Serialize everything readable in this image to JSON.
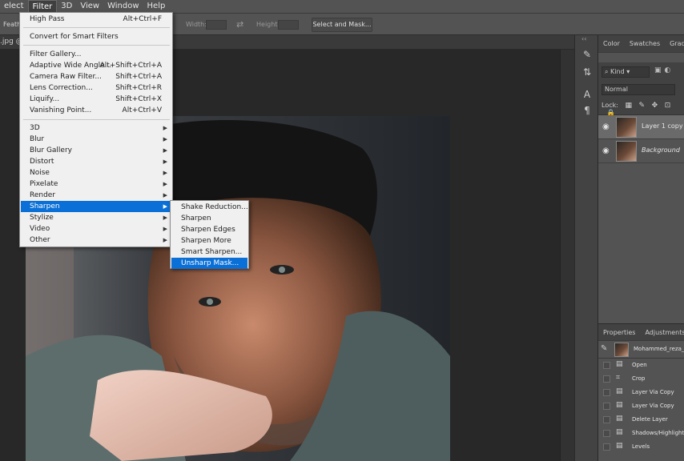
{
  "menubar": [
    "elect",
    "Filter",
    "3D",
    "View",
    "Window",
    "Help"
  ],
  "options": {
    "feather_label": "Feath",
    "width_label": "Width:",
    "height_label": "Height:",
    "select_mask_button": "Select and Mask..."
  },
  "doc_tab": ".jpg @",
  "filter_menu": {
    "items": [
      {
        "label": "High Pass",
        "shortcut": "Alt+Ctrl+F"
      },
      {
        "label": "Convert for Smart Filters",
        "shortcut": ""
      },
      {
        "label": "Filter Gallery...",
        "shortcut": ""
      },
      {
        "label": "Adaptive Wide Angle...",
        "shortcut": "Alt+Shift+Ctrl+A"
      },
      {
        "label": "Camera Raw Filter...",
        "shortcut": "Shift+Ctrl+A"
      },
      {
        "label": "Lens Correction...",
        "shortcut": "Shift+Ctrl+R"
      },
      {
        "label": "Liquify...",
        "shortcut": "Shift+Ctrl+X"
      },
      {
        "label": "Vanishing Point...",
        "shortcut": "Alt+Ctrl+V"
      },
      {
        "label": "3D",
        "shortcut": ""
      },
      {
        "label": "Blur",
        "shortcut": ""
      },
      {
        "label": "Blur Gallery",
        "shortcut": ""
      },
      {
        "label": "Distort",
        "shortcut": ""
      },
      {
        "label": "Noise",
        "shortcut": ""
      },
      {
        "label": "Pixelate",
        "shortcut": ""
      },
      {
        "label": "Render",
        "shortcut": ""
      },
      {
        "label": "Sharpen",
        "shortcut": ""
      },
      {
        "label": "Stylize",
        "shortcut": ""
      },
      {
        "label": "Video",
        "shortcut": ""
      },
      {
        "label": "Other",
        "shortcut": ""
      }
    ]
  },
  "sharpen_submenu": {
    "items": [
      "Shake Reduction...",
      "Sharpen",
      "Sharpen Edges",
      "Sharpen More",
      "Smart Sharpen...",
      "Unsharp Mask..."
    ]
  },
  "panels": {
    "top_tabs": [
      "Color",
      "Swatches",
      "Gradie"
    ],
    "kind_label": "Kind",
    "blend_mode": "Normal",
    "lock_label": "Lock:",
    "layers": [
      {
        "name": "Layer 1 copy",
        "selected": true
      },
      {
        "name": "Background",
        "selected": false
      }
    ],
    "lower_tabs": [
      "Properties",
      "Adjustments"
    ],
    "history_snapshot": "Mohammed_reza_g",
    "history": [
      "Open",
      "Crop",
      "Layer Via Copy",
      "Layer Via Copy",
      "Delete Layer",
      "Shadows/Highlights",
      "Levels"
    ]
  },
  "colors": {
    "menu_highlight": "#0a6fd6",
    "panel_bg": "#535353",
    "canvas_bg": "#282828"
  }
}
